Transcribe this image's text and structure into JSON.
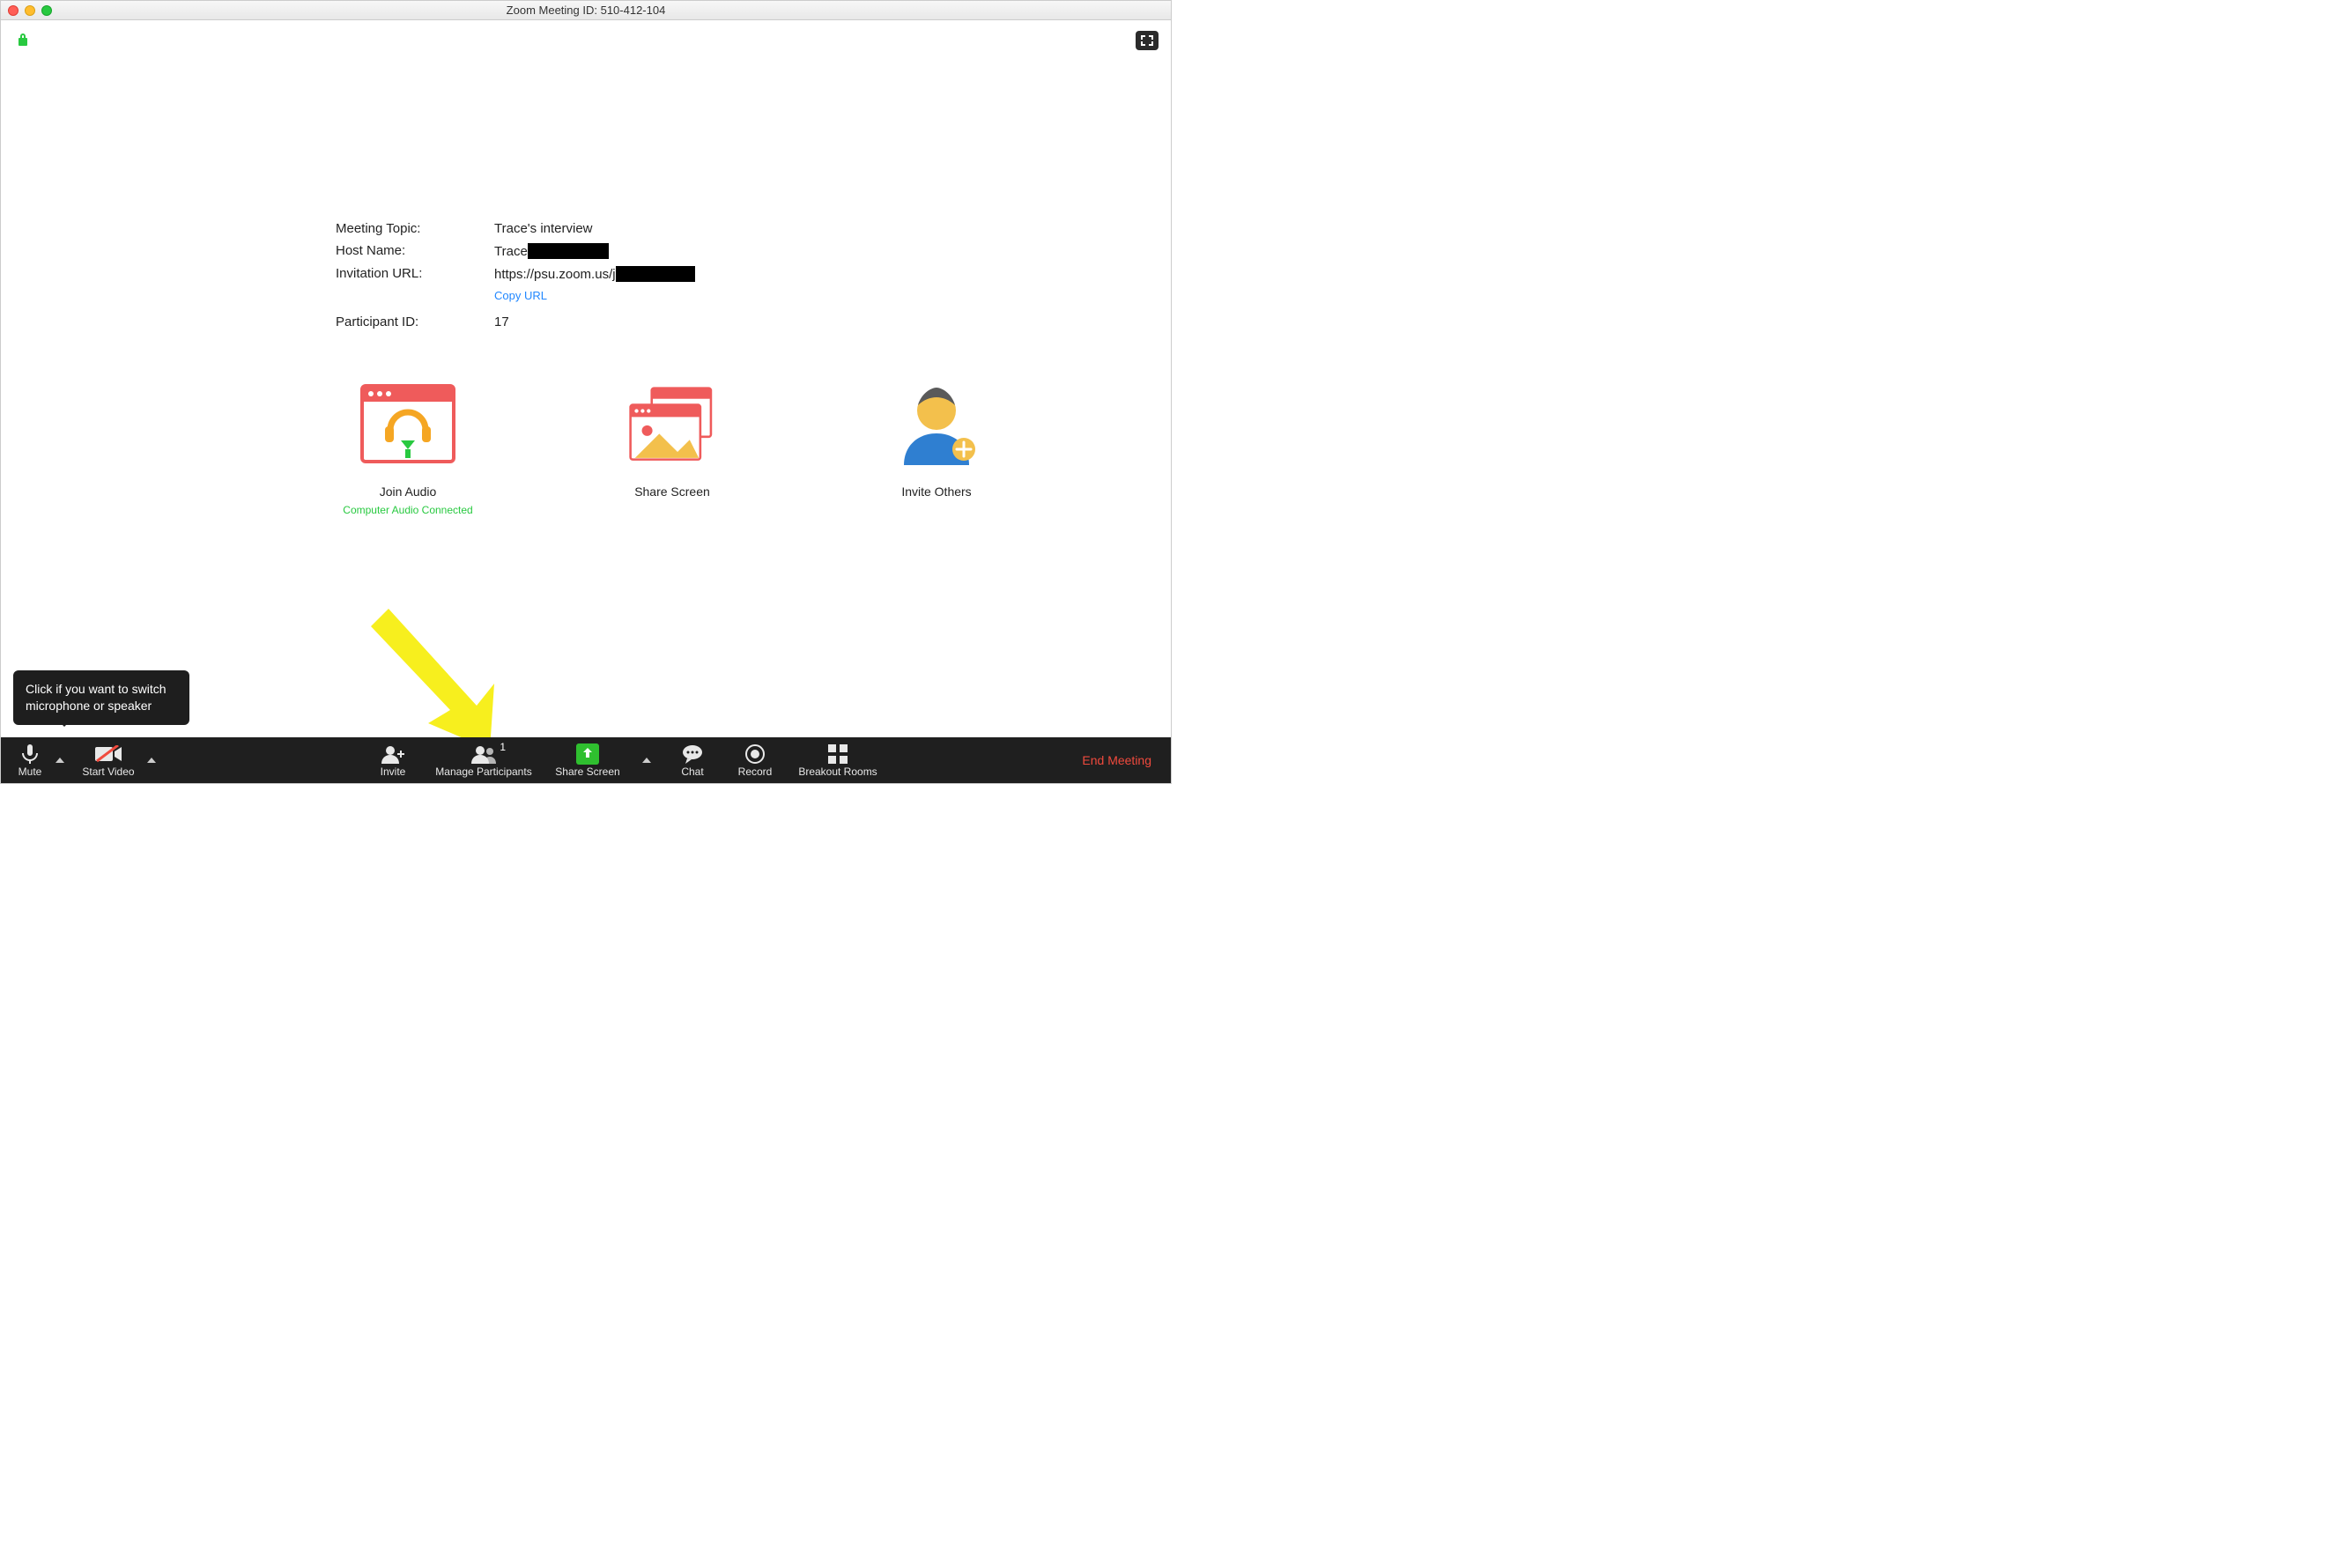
{
  "window": {
    "title": "Zoom Meeting ID: 510-412-104"
  },
  "info": {
    "topic_label": "Meeting Topic:",
    "topic_value": "Trace's interview",
    "host_label": "Host Name:",
    "host_value_prefix": "Trace",
    "url_label": "Invitation URL:",
    "url_value_prefix": "https://psu.zoom.us/j",
    "copy_url": "Copy URL",
    "pid_label": "Participant ID:",
    "pid_value": "17"
  },
  "tiles": {
    "join_audio": {
      "label": "Join Audio",
      "sublabel": "Computer Audio Connected"
    },
    "share_screen": {
      "label": "Share Screen"
    },
    "invite_others": {
      "label": "Invite Others"
    }
  },
  "tooltip": {
    "text": "Click if you want to switch microphone or speaker"
  },
  "toolbar": {
    "mute": "Mute",
    "start_video": "Start Video",
    "invite": "Invite",
    "manage_participants": "Manage Participants",
    "participant_count": "1",
    "share_screen": "Share Screen",
    "chat": "Chat",
    "record": "Record",
    "breakout": "Breakout Rooms",
    "end": "End Meeting"
  }
}
